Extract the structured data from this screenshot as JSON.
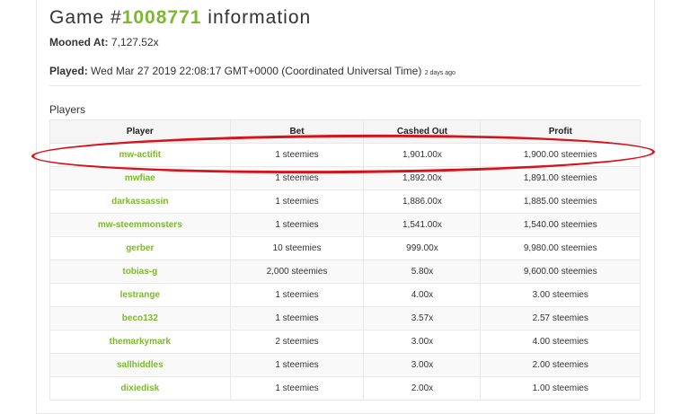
{
  "title": {
    "prefix": "Game #",
    "game_id": "1008771",
    "suffix": " information"
  },
  "mooned": {
    "label": "Mooned At:",
    "value": "7,127.52x"
  },
  "played": {
    "label": "Played:",
    "value": "Wed Mar 27 2019 22:08:17 GMT+0000 (Coordinated Universal Time)",
    "ago": "2 days ago"
  },
  "players_heading": "Players",
  "columns": [
    "Player",
    "Bet",
    "Cashed Out",
    "Profit"
  ],
  "rows": [
    [
      "mw-actifit",
      "1 steemies",
      "1,901.00x",
      "1,900.00 steemies"
    ],
    [
      "mwfiae",
      "1 steemies",
      "1,892.00x",
      "1,891.00 steemies"
    ],
    [
      "darkassassin",
      "1 steemies",
      "1,886.00x",
      "1,885.00 steemies"
    ],
    [
      "mw-steemmonsters",
      "1 steemies",
      "1,541.00x",
      "1,540.00 steemies"
    ],
    [
      "gerber",
      "10 steemies",
      "999.00x",
      "9,980.00 steemies"
    ],
    [
      "tobias-g",
      "2,000 steemies",
      "5.80x",
      "9,600.00 steemies"
    ],
    [
      "lestrange",
      "1 steemies",
      "4.00x",
      "3.00 steemies"
    ],
    [
      "beco132",
      "1 steemies",
      "3.57x",
      "2.57 steemies"
    ],
    [
      "themarkymark",
      "2 steemies",
      "3.00x",
      "4.00 steemies"
    ],
    [
      "sallhiddles",
      "1 steemies",
      "3.00x",
      "2.00 steemies"
    ],
    [
      "dixiedisk",
      "1 steemies",
      "2.00x",
      "1.00 steemies"
    ]
  ],
  "colors": {
    "accent": "#7cb82f",
    "highlight": "#d8121a"
  }
}
